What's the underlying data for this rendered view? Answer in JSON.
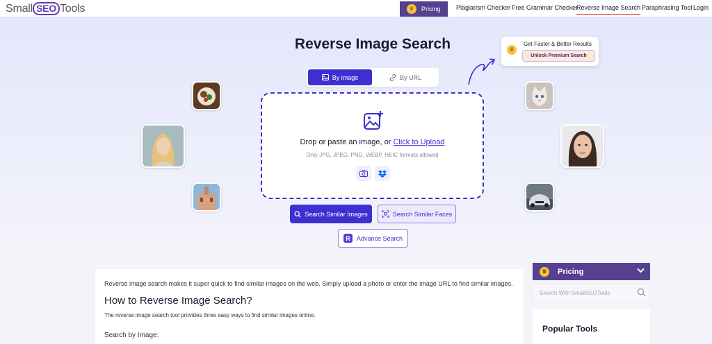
{
  "nav": {
    "logo": {
      "left": "Small",
      "mid": "SEO",
      "right": "Tools"
    },
    "pricing": "Pricing",
    "links": [
      "Plagiarism Checker",
      "Free Grammar Checker",
      "Reverse Image Search",
      "Paraphrasing Tool",
      "Login"
    ],
    "active_link": "Reverse Image Search"
  },
  "hero": {
    "title": "Reverse Image Search",
    "tabs": [
      {
        "label": "By image",
        "active": true
      },
      {
        "label": "By URL",
        "active": false
      }
    ],
    "dropzone": {
      "text": "Drop or paste an image, or ",
      "link": "Click to Upload",
      "formats": "Only JPG, JPEG, PNG, WEBP, HEIC formats allowed"
    },
    "buttons": {
      "search_similar": "Search Similar Images",
      "search_faces": "Search Similar Faces",
      "advance": "Advance Search"
    }
  },
  "promo": {
    "title": "Get Faster & Better Results",
    "button": "Unlock Premium Search"
  },
  "article": {
    "intro": "Reverse image search makes it super quick to find similar images on the web. Simply upload a photo or enter the image URL to find similar images.",
    "heading": "How to Reverse Image Search?",
    "paragraph": "The reverse image search tool provides three easy ways to find similar images online.",
    "subheading": "Search by Image:"
  },
  "sidebar": {
    "pricing": "Pricing",
    "search_placeholder": "Search With SmallSEOTools",
    "popular_title": "Popular Tools"
  },
  "colors": {
    "primary": "#3d2fd1",
    "nav_purple": "#55418f",
    "crown": "#f6c33b",
    "active_underline": "#e02a2a"
  },
  "icons": {
    "crown": "crown-icon",
    "image": "image-icon",
    "link": "link-icon",
    "upload": "image-plus-icon",
    "camera": "camera-icon",
    "dropbox": "dropbox-icon",
    "search": "search-icon",
    "face_scan": "face-scan-icon",
    "chevron": "chevron-down-icon"
  }
}
